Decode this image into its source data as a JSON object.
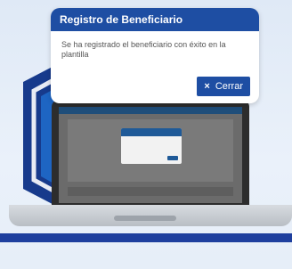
{
  "modal": {
    "title": "Registro de Beneficiario",
    "message": "Se ha registrado el beneficiario con éxito en la plantilla",
    "close_label": "Cerrar",
    "close_icon": "close-icon"
  },
  "colors": {
    "modal_header": "#1e4ea3",
    "button": "#1e4ea3",
    "background": "#e8f0f9",
    "hex_dark": "#173a8c",
    "hex_light": "#1f67c6"
  }
}
